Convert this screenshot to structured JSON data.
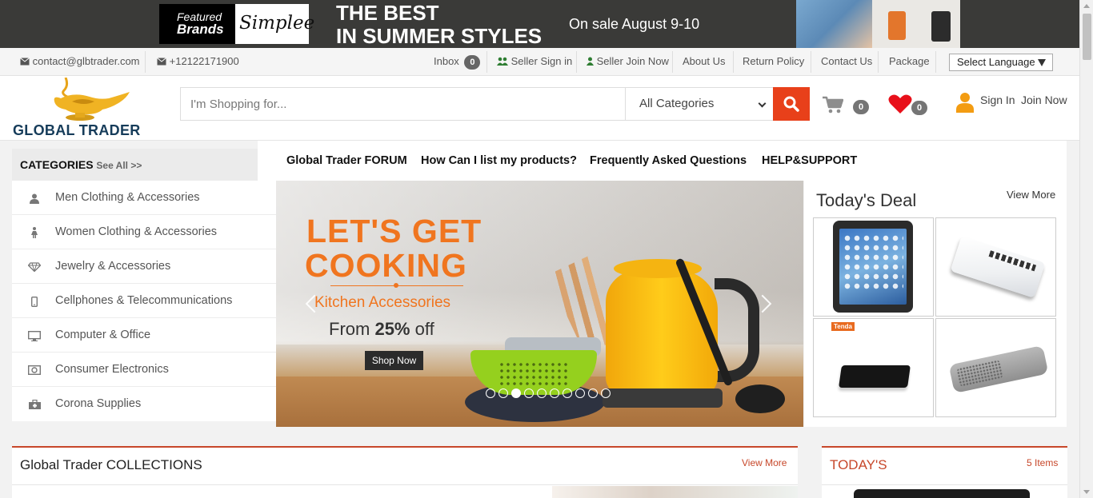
{
  "promo": {
    "brand_featured": "Featured",
    "brand_brands": "Brands",
    "brand_name": "Simplee",
    "headline_1": "THE BEST",
    "headline_2": "IN SUMMER STYLES",
    "sale_text": "On sale August 9-10"
  },
  "topbar": {
    "email": "contact@glbtrader.com",
    "phone": "+12122171900",
    "inbox_label": "Inbox",
    "inbox_count": "0",
    "seller_sign_in": "Seller Sign in",
    "seller_join_now": "Seller Join Now",
    "about_us": "About Us",
    "return_policy": "Return Policy",
    "contact_us": "Contact Us",
    "package": "Package",
    "language_select": "Select Language"
  },
  "header": {
    "logo_text": "GLOBAL TRADER",
    "search_placeholder": "I'm Shopping for...",
    "category_select": "All Categories",
    "cart_count": "0",
    "wishlist_count": "0",
    "sign_in": "Sign In",
    "join_now": "Join Now"
  },
  "categories": {
    "heading": "CATEGORIES",
    "see_all": "See All >>",
    "items": [
      {
        "label": "Men Clothing & Accessories",
        "icon": "user-icon"
      },
      {
        "label": "Women Clothing & Accessories",
        "icon": "female-icon"
      },
      {
        "label": "Jewelry & Accessories",
        "icon": "diamond-icon"
      },
      {
        "label": "Cellphones & Telecommunications",
        "icon": "mobile-icon"
      },
      {
        "label": "Computer & Office",
        "icon": "desktop-icon"
      },
      {
        "label": "Consumer Electronics",
        "icon": "camera-icon"
      },
      {
        "label": "Corona Supplies",
        "icon": "medkit-icon"
      }
    ]
  },
  "nav": {
    "forum": "Global Trader FORUM",
    "list_products": "How Can I list my products?",
    "faq": "Frequently Asked Questions",
    "help": "HELP&SUPPORT"
  },
  "slider": {
    "line1": "LET'S GET",
    "line2": "COOKING",
    "line3": "Kitchen Accessories",
    "line4_prefix": "From ",
    "line4_bold": "25%",
    "line4_suffix": " off",
    "button": "Shop Now",
    "slide_count": 10,
    "active_slide": 3
  },
  "deal": {
    "title": "Today's Deal",
    "view_more": "View More",
    "tenda_logo": "Tenda"
  },
  "collections": {
    "title": "Global Trader COLLECTIONS",
    "view_more": "View More"
  },
  "todays": {
    "title": "TODAY'S",
    "count": "5 Items"
  },
  "colors": {
    "accent": "#e8401a",
    "section_accent": "#c7472a",
    "headline_orange": "#f0751f",
    "logo_navy": "#163c5a",
    "wishlist_red": "#e8101a",
    "user_orange": "#f39c12"
  }
}
